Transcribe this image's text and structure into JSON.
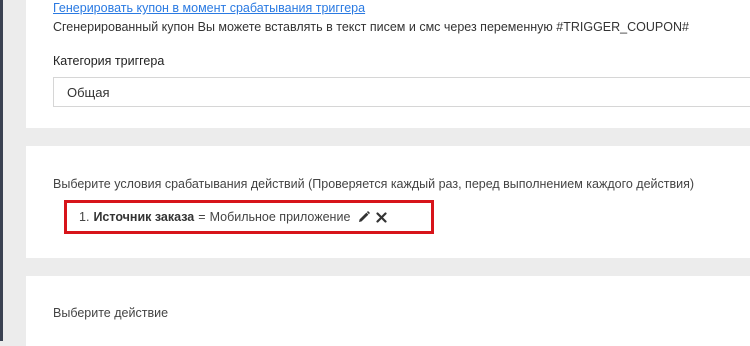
{
  "trigger": {
    "generate_coupon_link": "Генерировать купон в момент срабатывания триггера",
    "coupon_hint": "Сгенерированный купон Вы можете вставлять в текст писем и смс через переменную #TRIGGER_COUPON#",
    "category_label": "Категория триггера",
    "category_value": "Общая"
  },
  "conditions": {
    "prompt": "Выберите условия срабатывания действий (Проверяется каждый раз, перед выполнением каждого действия)",
    "items": [
      {
        "number": "1.",
        "field": "Источник заказа",
        "operator": "=",
        "value": "Мобильное приложение",
        "edit_icon": "pencil-icon",
        "remove_icon": "close-icon"
      }
    ]
  },
  "action": {
    "prompt": "Выберите действие"
  },
  "colors": {
    "link": "#2a7ae2",
    "highlight_border": "#d7141a",
    "background": "#ececec"
  }
}
